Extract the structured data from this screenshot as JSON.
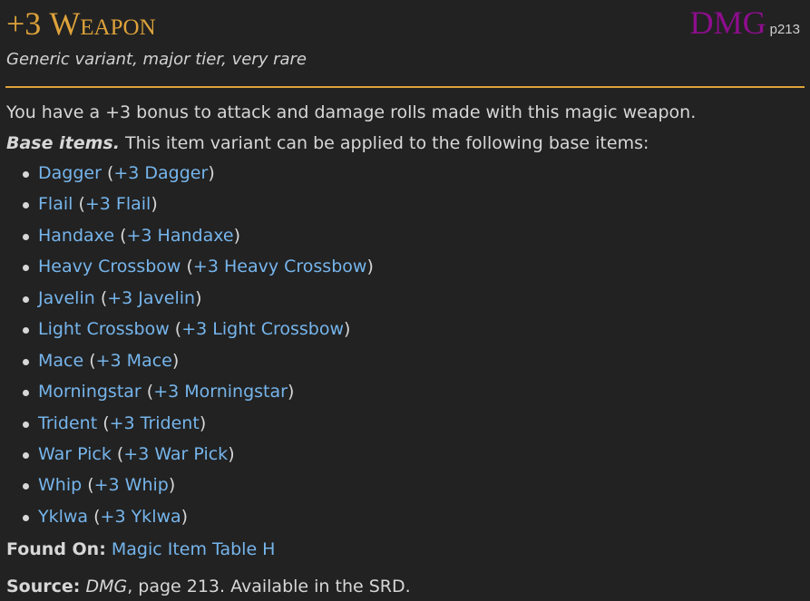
{
  "header": {
    "title_prefix": "+3 ",
    "title_word": "Weapon",
    "source_abbr": "DMG",
    "source_page": "p213"
  },
  "subtitle": "Generic variant, major tier, very rare",
  "description": "You have a +3 bonus to attack and damage rolls made with this magic weapon.",
  "base_items": {
    "label": "Base items.",
    "text": "This item variant can be applied to the following base items:",
    "items": [
      {
        "base": "Dagger",
        "variant": "+3 Dagger"
      },
      {
        "base": "Flail",
        "variant": "+3 Flail"
      },
      {
        "base": "Handaxe",
        "variant": "+3 Handaxe"
      },
      {
        "base": "Heavy Crossbow",
        "variant": "+3 Heavy Crossbow"
      },
      {
        "base": "Javelin",
        "variant": "+3 Javelin"
      },
      {
        "base": "Light Crossbow",
        "variant": "+3 Light Crossbow"
      },
      {
        "base": "Mace",
        "variant": "+3 Mace"
      },
      {
        "base": "Morningstar",
        "variant": "+3 Morningstar"
      },
      {
        "base": "Trident",
        "variant": "+3 Trident"
      },
      {
        "base": "War Pick",
        "variant": "+3 War Pick"
      },
      {
        "base": "Whip",
        "variant": "+3 Whip"
      },
      {
        "base": "Yklwa",
        "variant": "+3 Yklwa"
      }
    ]
  },
  "found_on": {
    "label": "Found On:",
    "link": "Magic Item Table H"
  },
  "source": {
    "label": "Source:",
    "book": "DMG",
    "rest": ", page 213. Available in the SRD."
  },
  "colors": {
    "background": "#222222",
    "title": "#dda23a",
    "source_abbr": "#8d0d8d",
    "link": "#76b5ec",
    "text": "#d7d7d7"
  }
}
